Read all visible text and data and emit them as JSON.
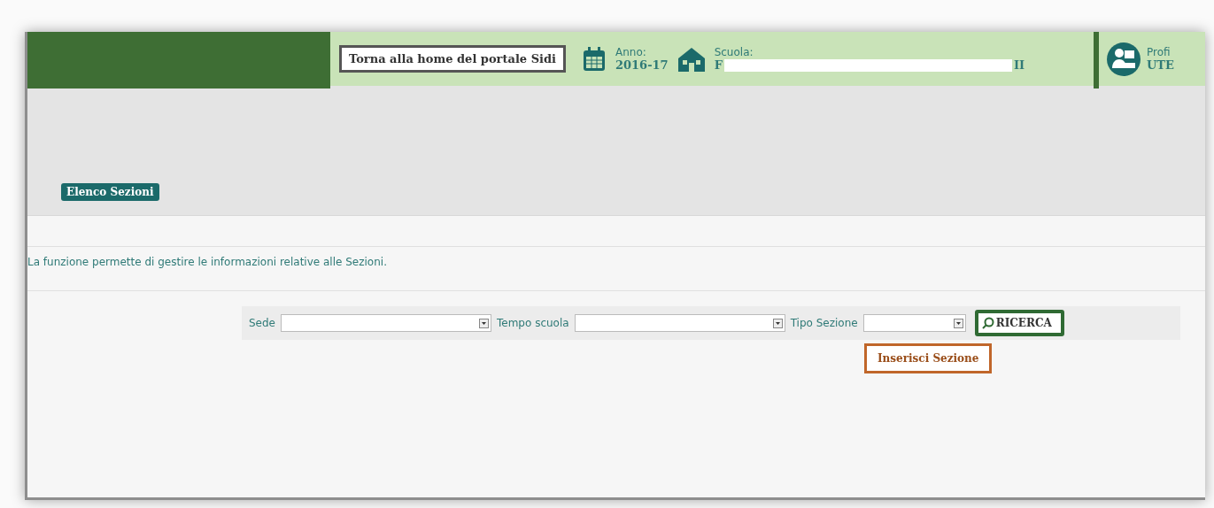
{
  "header": {
    "home_button": "Torna alla home del portale Sidi",
    "year": {
      "label": "Anno:",
      "value": "2016-17"
    },
    "school": {
      "label": "Scuola:",
      "value_start": "F",
      "value_end": "II"
    },
    "profile": {
      "label": "Profi",
      "value": "UTE"
    }
  },
  "section_tab": "Elenco Sezioni",
  "description": "La funzione permette di gestire le informazioni relative alle Sezioni.",
  "filters": [
    {
      "label": "Sede",
      "kind": "wide"
    },
    {
      "label": "Tempo scuola",
      "kind": "wide"
    },
    {
      "label": "Tipo Sezione",
      "kind": "narrow"
    }
  ],
  "search_button": "RICERCA",
  "insert_button": "Inserisci Sezione"
}
